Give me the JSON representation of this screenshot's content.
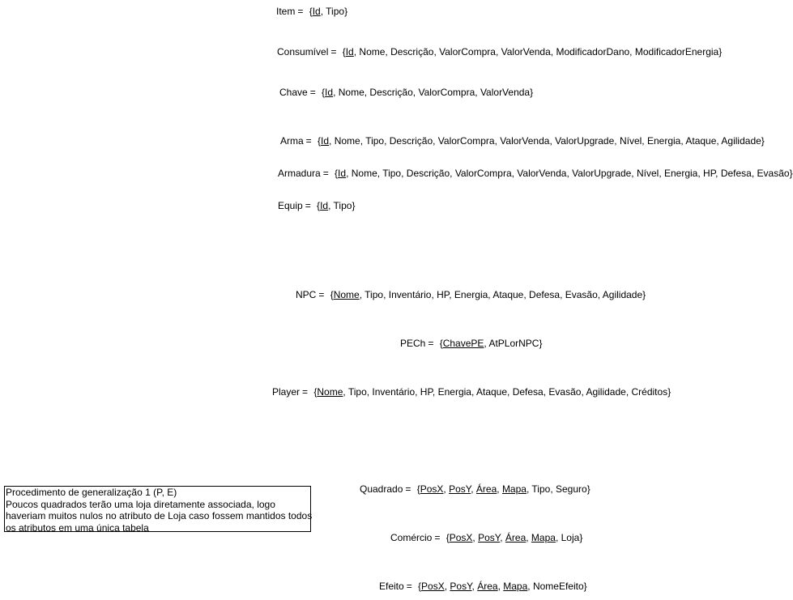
{
  "relations": [
    {
      "name": "Item",
      "attrs": [
        {
          "t": "Id",
          "k": true
        },
        {
          "t": "Tipo",
          "k": false
        }
      ]
    },
    {
      "name": "Consumível",
      "attrs": [
        {
          "t": "Id",
          "k": true
        },
        {
          "t": "Nome",
          "k": false
        },
        {
          "t": "Descrição",
          "k": false
        },
        {
          "t": "ValorCompra",
          "k": false
        },
        {
          "t": "ValorVenda",
          "k": false
        },
        {
          "t": "ModificadorDano",
          "k": false
        },
        {
          "t": "ModificadorEnergia",
          "k": false
        }
      ]
    },
    {
      "name": "Chave",
      "attrs": [
        {
          "t": "Id",
          "k": true
        },
        {
          "t": "Nome",
          "k": false
        },
        {
          "t": "Descrição",
          "k": false
        },
        {
          "t": "ValorCompra",
          "k": false
        },
        {
          "t": "ValorVenda",
          "k": false
        }
      ]
    },
    {
      "name": "Arma",
      "attrs": [
        {
          "t": "Id",
          "k": true
        },
        {
          "t": "Nome",
          "k": false
        },
        {
          "t": "Tipo",
          "k": false
        },
        {
          "t": "Descrição",
          "k": false
        },
        {
          "t": "ValorCompra",
          "k": false
        },
        {
          "t": "ValorVenda",
          "k": false
        },
        {
          "t": "ValorUpgrade",
          "k": false
        },
        {
          "t": "Nível",
          "k": false
        },
        {
          "t": "Energia",
          "k": false
        },
        {
          "t": "Ataque",
          "k": false
        },
        {
          "t": "Agilidade",
          "k": false
        }
      ]
    },
    {
      "name": "Armadura",
      "attrs": [
        {
          "t": "Id",
          "k": true
        },
        {
          "t": "Nome",
          "k": false
        },
        {
          "t": "Tipo",
          "k": false
        },
        {
          "t": "Descrição",
          "k": false
        },
        {
          "t": "ValorCompra",
          "k": false
        },
        {
          "t": "ValorVenda",
          "k": false
        },
        {
          "t": "ValorUpgrade",
          "k": false
        },
        {
          "t": "Nível",
          "k": false
        },
        {
          "t": "Energia",
          "k": false
        },
        {
          "t": "HP",
          "k": false
        },
        {
          "t": "Defesa",
          "k": false
        },
        {
          "t": "Evasão",
          "k": false
        }
      ]
    },
    {
      "name": "Equip",
      "attrs": [
        {
          "t": "Id",
          "k": true
        },
        {
          "t": "Tipo",
          "k": false
        }
      ]
    },
    {
      "name": "NPC",
      "attrs": [
        {
          "t": "Nome",
          "k": true
        },
        {
          "t": "Tipo",
          "k": false
        },
        {
          "t": "Inventário",
          "k": false
        },
        {
          "t": "HP",
          "k": false
        },
        {
          "t": "Energia",
          "k": false
        },
        {
          "t": "Ataque",
          "k": false
        },
        {
          "t": "Defesa",
          "k": false
        },
        {
          "t": "Evasão",
          "k": false
        },
        {
          "t": "Agilidade",
          "k": false
        }
      ]
    },
    {
      "name": "PECh",
      "attrs": [
        {
          "t": "ChavePE",
          "k": true
        },
        {
          "t": "AtPLorNPC",
          "k": false
        }
      ]
    },
    {
      "name": "Player",
      "attrs": [
        {
          "t": "Nome",
          "k": true
        },
        {
          "t": "Tipo",
          "k": false
        },
        {
          "t": "Inventário",
          "k": false
        },
        {
          "t": "HP",
          "k": false
        },
        {
          "t": "Energia",
          "k": false
        },
        {
          "t": "Ataque",
          "k": false
        },
        {
          "t": "Defesa",
          "k": false
        },
        {
          "t": "Evasão",
          "k": false
        },
        {
          "t": "Agilidade",
          "k": false
        },
        {
          "t": "Créditos",
          "k": false
        }
      ]
    },
    {
      "name": "Quadrado",
      "attrs": [
        {
          "t": "PosX",
          "k": true
        },
        {
          "t": "PosY",
          "k": true
        },
        {
          "t": "Área",
          "k": true
        },
        {
          "t": "Mapa",
          "k": true
        },
        {
          "t": "Tipo",
          "k": false
        },
        {
          "t": "Seguro",
          "k": false
        }
      ]
    },
    {
      "name": "Comércio",
      "attrs": [
        {
          "t": "PosX",
          "k": true
        },
        {
          "t": "PosY",
          "k": true
        },
        {
          "t": "Área",
          "k": true
        },
        {
          "t": "Mapa",
          "k": true
        },
        {
          "t": "Loja",
          "k": false
        }
      ]
    },
    {
      "name": "Efeito",
      "attrs": [
        {
          "t": "PosX",
          "k": true
        },
        {
          "t": "PosY",
          "k": true
        },
        {
          "t": "Área",
          "k": true
        },
        {
          "t": "Mapa",
          "k": true
        },
        {
          "t": "NomeEfeito",
          "k": false
        }
      ]
    }
  ],
  "note": {
    "lines": [
      "Procedimento de generalização 1 (P, E)",
      "Poucos quadrados terão uma loja diretamente associada, logo",
      "haveriam muitos nulos no atributo de Loja caso fossem mantidos todos",
      "os atributos em uma única tabela"
    ]
  }
}
